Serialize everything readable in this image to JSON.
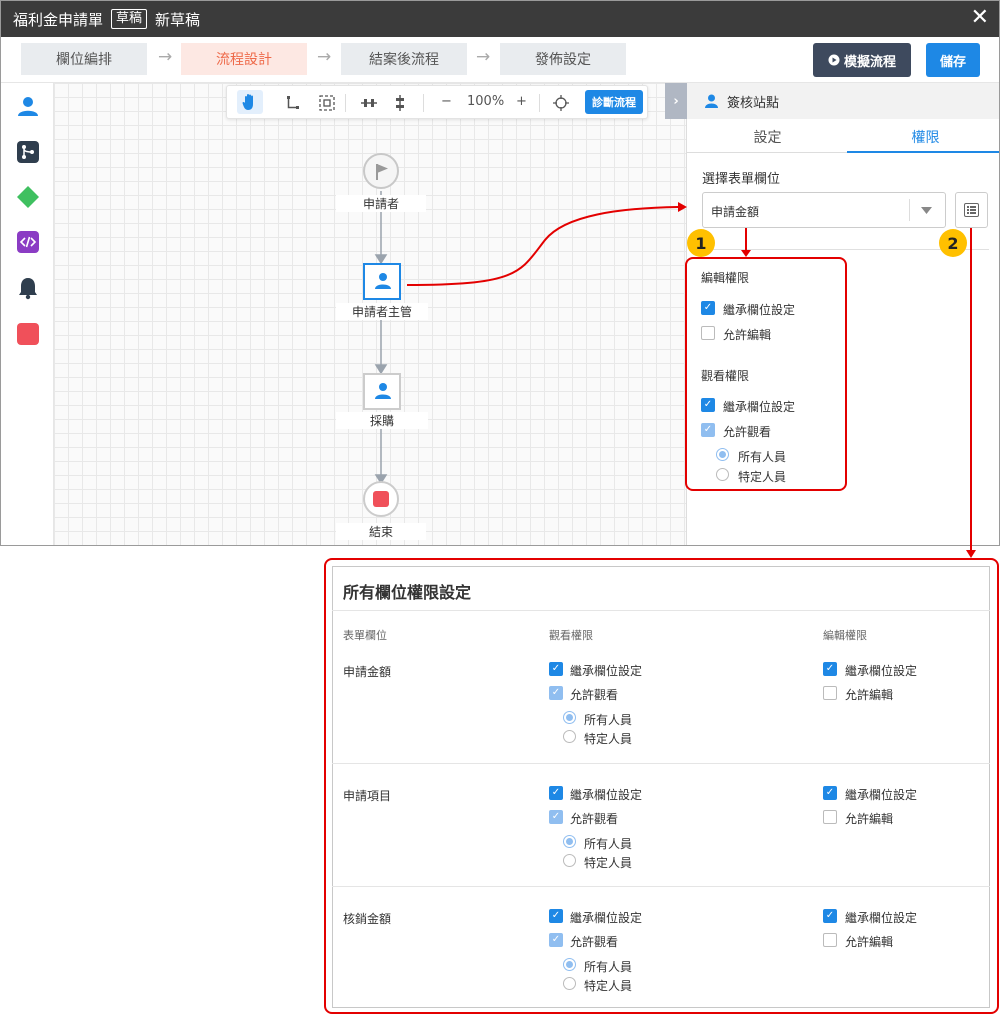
{
  "titlebar": {
    "title": "福利金申請單",
    "badge": "草稿",
    "draft_name": "新草稿",
    "close": "✕"
  },
  "steps": [
    {
      "label": "欄位編排",
      "active": false
    },
    {
      "label": "流程設計",
      "active": true
    },
    {
      "label": "結案後流程",
      "active": false
    },
    {
      "label": "發佈設定",
      "active": false
    }
  ],
  "step_arrow": "→",
  "buttons": {
    "simulate": "模擬流程",
    "save": "儲存"
  },
  "toolbar": {
    "zoom_out": "−",
    "zoom": "100%",
    "zoom_in": "+",
    "diagnose": "診斷流程"
  },
  "nodes": {
    "start": "申請者",
    "manager": "申請者主管",
    "purchase": "採購",
    "end": "結束"
  },
  "panel": {
    "header": "簽核站點",
    "collapse": "›",
    "tabs": [
      "設定",
      "權限"
    ],
    "active_tab": "權限",
    "field_label": "選擇表單欄位",
    "field_value": "申請金額",
    "edit_section": "編輯權限",
    "edit_inherit": "繼承欄位設定",
    "edit_allow": "允許編輯",
    "view_section": "觀看權限",
    "view_inherit": "繼承欄位設定",
    "view_allow": "允許觀看",
    "view_all": "所有人員",
    "view_specific": "特定人員"
  },
  "callouts": [
    "1",
    "2"
  ],
  "all_perms": {
    "title": "所有欄位權限設定",
    "col_field": "表單欄位",
    "col_view": "觀看權限",
    "col_edit": "編輯權限",
    "rows": [
      {
        "field": "申請金額",
        "view_inherit": "繼承欄位設定",
        "view_allow": "允許觀看",
        "all": "所有人員",
        "specific": "特定人員",
        "edit_inherit": "繼承欄位設定",
        "edit_allow": "允許編輯"
      },
      {
        "field": "申請項目",
        "view_inherit": "繼承欄位設定",
        "view_allow": "允許觀看",
        "all": "所有人員",
        "specific": "特定人員",
        "edit_inherit": "繼承欄位設定",
        "edit_allow": "允許編輯"
      },
      {
        "field": "核銷金額",
        "view_inherit": "繼承欄位設定",
        "view_allow": "允許觀看",
        "all": "所有人員",
        "specific": "特定人員",
        "edit_inherit": "繼承欄位設定",
        "edit_allow": "允許編輯"
      }
    ]
  },
  "colors": {
    "accent": "#1e88e5",
    "active_step": "#ee6a4a",
    "callout_red": "#e30000",
    "callout_badge": "#ffc000"
  }
}
